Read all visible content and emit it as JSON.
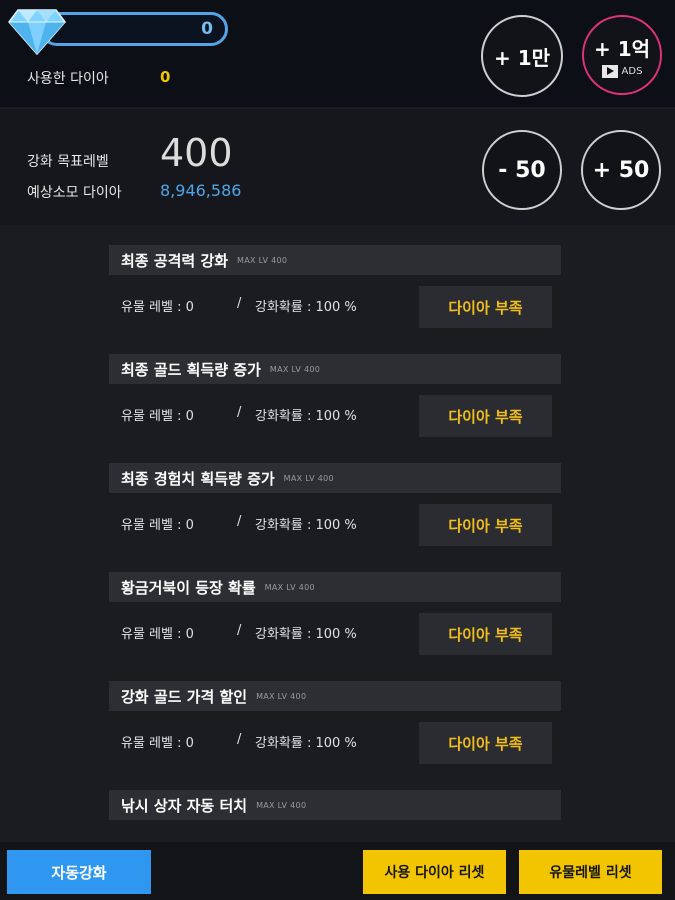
{
  "header": {
    "diamond_count": "0",
    "used_diamond_label": "사용한 다이아",
    "used_diamond_value": "0",
    "btn_add_10k": "+ 1만",
    "btn_add_100m": "+ 1억",
    "ads_label": "ADS"
  },
  "level": {
    "target_label": "강화 목표레벨",
    "target_value": "400",
    "cost_label": "예상소모 다이아",
    "cost_value": "8,946,586",
    "btn_minus": "- 50",
    "btn_plus": "+ 50"
  },
  "items": [
    {
      "title": "최종 공격력 강화",
      "max": "MAX LV 400",
      "relic_level": "유물 레벨 : 0",
      "slash": "/",
      "chance": "강화확률 : 100 %",
      "button": "다이아 부족"
    },
    {
      "title": "최종 골드 획득량 증가",
      "max": "MAX LV 400",
      "relic_level": "유물 레벨 : 0",
      "slash": "/",
      "chance": "강화확률 : 100 %",
      "button": "다이아 부족"
    },
    {
      "title": "최종 경험치 획득량 증가",
      "max": "MAX LV 400",
      "relic_level": "유물 레벨 : 0",
      "slash": "/",
      "chance": "강화확률 : 100 %",
      "button": "다이아 부족"
    },
    {
      "title": "황금거북이 등장 확률",
      "max": "MAX LV 400",
      "relic_level": "유물 레벨 : 0",
      "slash": "/",
      "chance": "강화확률 : 100 %",
      "button": "다이아 부족"
    },
    {
      "title": "강화 골드 가격 할인",
      "max": "MAX LV 400",
      "relic_level": "유물 레벨 : 0",
      "slash": "/",
      "chance": "강화확률 : 100 %",
      "button": "다이아 부족"
    },
    {
      "title": "낚시 상자 자동 터치",
      "max": "MAX LV 400"
    }
  ],
  "footer": {
    "auto_upgrade": "자동강화",
    "reset_used_diamond": "사용 다이아 리셋",
    "reset_relic_level": "유물레벨 리셋"
  }
}
